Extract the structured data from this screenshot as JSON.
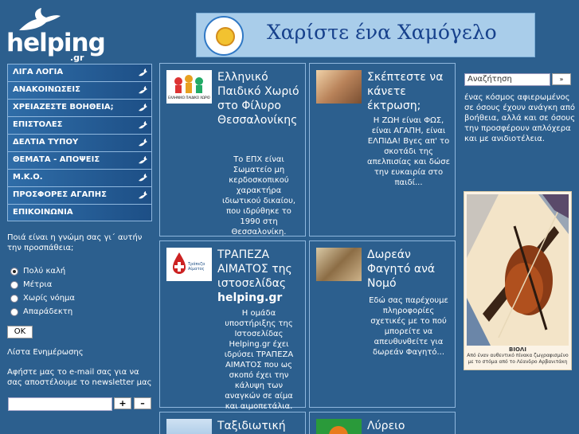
{
  "logo": {
    "text": "helping",
    "tld": ".gr"
  },
  "banner": {
    "text": "Χαρίστε ένα Χαμόγελο"
  },
  "menu": [
    "ΛΙΓΑ ΛΟΓΙΑ",
    "ΑΝΑΚΟΙΝΩΣΕΙΣ",
    "ΧΡΕΙΑΖΕΣΤΕ ΒΟΗΘΕΙΑ;",
    "ΕΠΙΣΤΟΛΕΣ",
    "ΔΕΛΤΙΑ ΤΥΠΟΥ",
    "ΘΕΜΑΤΑ - ΑΠΟΨΕΙΣ",
    "Μ.Κ.Ο.",
    "ΠΡΟΣΦΟΡΕΣ ΑΓΑΠΗΣ",
    "ΕΠΙΚΟΙΝΩΝΙΑ"
  ],
  "poll": {
    "question": "Ποιά είναι η γνώμη σας γι΄ αυτήν την προσπάθεια;",
    "options": [
      "Πολύ καλή",
      "Μέτρια",
      "Χωρίς νόημα",
      "Απαράδεκτη"
    ],
    "ok": "OK"
  },
  "newsletter": {
    "title": "Λίστα Ενημέρωσης",
    "text": "Αφήστε μας το e-mail σας για να σας αποστέλουμε το newsletter μας",
    "plus": "+",
    "minus": "–"
  },
  "cards": [
    {
      "title": "Ελληνικό Παιδικό Χωριό στο Φίλυρο Θεσσαλονίκης",
      "thumb_label": "ΕΛΛΗΝΙΚΟ ΠΑΙΔΙΚΟ ΧΩΡΙΟ",
      "body": "Το ΕΠΧ είναι Σωματείο μη κερδοσκοπικού χαρακτήρα ιδιωτικού δικαίου, που ιδρύθηκε το 1990 στη Θεσσαλονίκη."
    },
    {
      "title": "Σκέπτεστε να κάνετε έκτρωση;",
      "body": "Η ΖΩΗ είναι ΦΩΣ, είναι ΑΓΑΠΗ, είναι ΕΛΠΙΔΑ! Βγες απ' το σκοτάδι της απελπισίας και δώσε την ευκαιρία στο παιδί..."
    },
    {
      "title": "ΤΡΑΠΕΖΑ ΑΙΜΑΤΟΣ της ιστοσελίδας",
      "title_bold": "helping.gr",
      "thumb_label": "Τράπεζα Αίματος",
      "body": "Η ομάδα υποστήριξης της Ιστοσελίδας Helping.gr έχει ιδρύσει ΤΡΑΠΕΖΑ ΑΙΜΑΤΟΣ που ως σκοπό έχει την κάλυψη των αναγκών σε αίμα και αιμοπετάλια."
    },
    {
      "title": "Δωρεάν Φαγητό ανά Νομό",
      "body": "Εδώ σας παρέχουμε πληροφορίες σχετικές με το πού μπορείτε να απευθυνθείτε για δωρεάν Φαγητό..."
    },
    {
      "title": "Ταξιδιωτική"
    },
    {
      "title": "Λύρειο"
    }
  ],
  "search": {
    "placeholder": "Αναζήτηση",
    "button": "»"
  },
  "right_text": "ένας κόσμος αφιερωμένος σε όσους έχουν ανάγκη από βοήθεια, αλλά και σε όσους την προσφέρουν απλόχερα και με ανιδιοτέλεια.",
  "painting": {
    "title": "ΒΙΟΛΙ",
    "caption": "Από έναν αυθεντικό πίνακα ζωγραφισμένο με το στόμα από το Λέανδρο Αρβανιτάκη"
  }
}
